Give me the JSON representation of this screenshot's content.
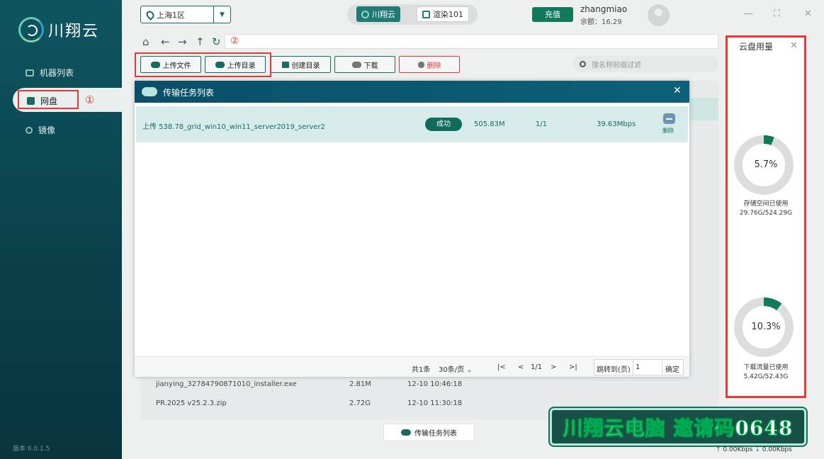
{
  "app": {
    "name": "川翔云",
    "version": "版本 6.0.1.5"
  },
  "sidebar": {
    "items": [
      {
        "label": "机器列表"
      },
      {
        "label": "网盘"
      },
      {
        "label": "镜像"
      }
    ],
    "annotation": "①"
  },
  "topbar": {
    "region": "上海1区",
    "tabs": [
      {
        "label": "川翔云"
      },
      {
        "label": "渲染101"
      }
    ],
    "recharge": "充值",
    "username": "zhangmiao",
    "balance": "余额：16.29"
  },
  "toolbar": {
    "annotation": "②",
    "buttons": [
      {
        "label": "上传文件"
      },
      {
        "label": "上传目录"
      },
      {
        "label": "创建目录"
      },
      {
        "label": "下载"
      },
      {
        "label": "删除"
      }
    ],
    "search_placeholder": "搜名称前缀过滤"
  },
  "files": [
    {
      "name": "jianying_32784790871010_installer.exe",
      "size": "2.81M",
      "time": "12-10 10:46:18"
    },
    {
      "name": "PR.2025 v25.2.3.zip",
      "size": "2.72G",
      "time": "12-10 11:30:18"
    }
  ],
  "transfer_tab": "传输任务列表",
  "modal": {
    "title": "传输任务列表",
    "tasks": [
      {
        "name": "上传 538.78_grid_win10_win11_server2019_server20",
        "status": "成功",
        "size": "505.83M",
        "progress": "1/1",
        "speed": "39.63Mbps",
        "action": "删除"
      }
    ],
    "footer": {
      "total": "共1条",
      "per_page": "30条/页",
      "page": "1/1",
      "jump_label": "跳转到(页)",
      "jump_value": "1",
      "confirm": "确定"
    }
  },
  "cloud_usage": {
    "title": "云盘用量",
    "storage": {
      "percent": "5.7%",
      "fraction": 0.057,
      "caption": "存储空间已使用",
      "value": "29.76G/524.29G"
    },
    "traffic": {
      "percent": "10.3%",
      "fraction": 0.103,
      "caption": "下载流量已使用",
      "value": "5.42G/52.43G"
    }
  },
  "banner": "川翔云电脑 邀请码0648",
  "speed": {
    "up": "0.00Kbps",
    "down": "0.00Kbps"
  },
  "colors": {
    "accent": "#1a6a62",
    "highlight": "#e53935",
    "sidebar": "#0e5560"
  }
}
